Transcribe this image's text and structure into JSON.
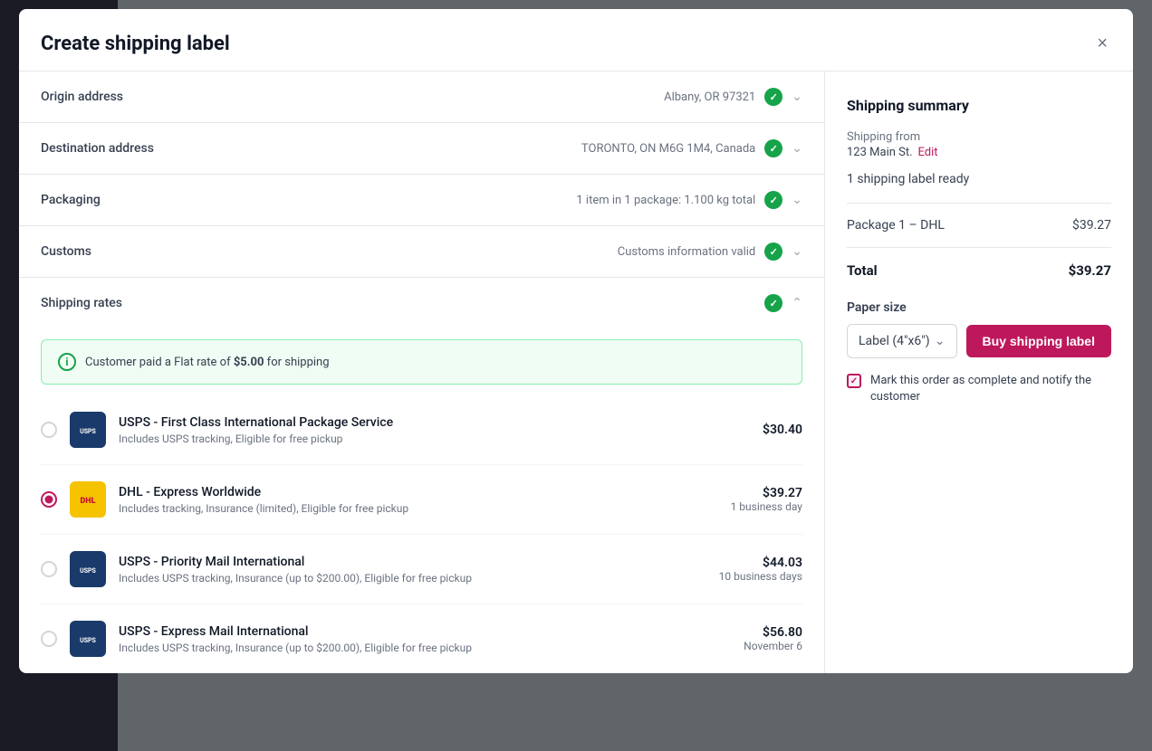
{
  "modal": {
    "title": "Create shipping label",
    "close_label": "×"
  },
  "accordion": {
    "origin": {
      "label": "Origin address",
      "value": "Albany, OR  97321",
      "has_check": true
    },
    "destination": {
      "label": "Destination address",
      "value": "TORONTO, ON  M6G 1M4, Canada",
      "has_check": true
    },
    "packaging": {
      "label": "Packaging",
      "value": "1 item in 1 package: 1.100 kg total",
      "has_check": true
    },
    "customs": {
      "label": "Customs",
      "value": "Customs information valid",
      "has_check": true
    },
    "shipping_rates": {
      "label": "Shipping rates",
      "has_check": true
    }
  },
  "info_banner": {
    "text_before": "Customer paid a Flat rate of ",
    "amount": "$5.00",
    "text_after": " for shipping"
  },
  "rates": [
    {
      "id": "usps-first",
      "carrier": "USPS",
      "carrier_type": "usps",
      "name": "USPS - First Class International Package Service",
      "description": "Includes USPS tracking, Eligible for free pickup",
      "price": "$30.40",
      "delivery": "",
      "selected": false
    },
    {
      "id": "dhl-express",
      "carrier": "DHL",
      "carrier_type": "dhl",
      "name": "DHL - Express Worldwide",
      "description": "Includes tracking, Insurance (limited), Eligible for free pickup",
      "price": "$39.27",
      "delivery": "1 business day",
      "selected": true
    },
    {
      "id": "usps-priority",
      "carrier": "USPS",
      "carrier_type": "usps",
      "name": "USPS - Priority Mail International",
      "description": "Includes USPS tracking, Insurance (up to $200.00), Eligible for free pickup",
      "price": "$44.03",
      "delivery": "10 business days",
      "selected": false
    },
    {
      "id": "usps-express",
      "carrier": "USPS",
      "carrier_type": "usps",
      "name": "USPS - Express Mail International",
      "description": "Includes USPS tracking, Insurance (up to $200.00), Eligible for free pickup",
      "price": "$56.80",
      "delivery": "November 6",
      "selected": false
    }
  ],
  "summary": {
    "title": "Shipping summary",
    "from_label": "Shipping from",
    "address": "123 Main St.",
    "edit_label": "Edit",
    "ready_label": "1 shipping label ready",
    "package_label": "Package 1 – DHL",
    "package_price": "$39.27",
    "total_label": "Total",
    "total_price": "$39.27",
    "paper_size_label": "Paper size",
    "paper_size_value": "Label (4\"x6\")",
    "buy_button_label": "Buy shipping label",
    "checkbox_label": "Mark this order as complete and notify the customer",
    "checkbox_checked": true
  }
}
